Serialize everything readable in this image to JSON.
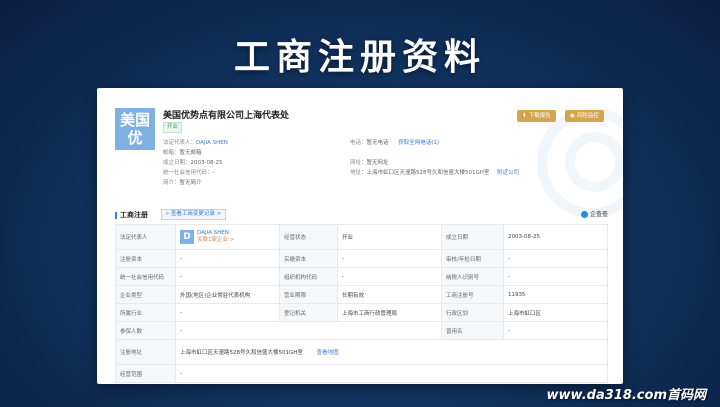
{
  "slide_title": "工商注册资料",
  "company": {
    "logo_text": "美国\n优",
    "name": "美国优势点有限公司上海代表处",
    "status": "开业",
    "legal_rep_label": "法定代表人：",
    "legal_rep": "DAJIA SHEN",
    "email_label": "邮箱：",
    "email": "暂无邮箱",
    "founded_label": "成立日期：",
    "founded": "2003-08-25",
    "credit_code_label": "统一社会信用代码：",
    "credit_code": "-",
    "intro_label": "简介：",
    "intro": "暂无简介",
    "phone_label": "电话：",
    "phone": "暂无电话",
    "phone_more": "获取全网电话(1)",
    "website_label": "网址：",
    "website": "暂无网址",
    "address_label": "地址：",
    "address": "上海市虹口区天潼路528号久和信盛大楼501GH室",
    "nearby": "附近公司"
  },
  "buttons": {
    "download_report": "下载报告",
    "risk_monitor": "风险监控"
  },
  "section": {
    "title": "工商注册",
    "history_link": "查看工商变更记录 >",
    "source": "企查查"
  },
  "table": {
    "legal_rep_label": "法定代表人",
    "rep_avatar": "D",
    "rep_name": "DAJIA SHEN",
    "rep_related": "关联1家企业 >",
    "biz_status_label": "经营状态",
    "biz_status": "开业",
    "founded_label": "成立日期",
    "founded": "2003-08-25",
    "reg_capital_label": "注册资本",
    "reg_capital": "-",
    "paid_capital_label": "实缴资本",
    "paid_capital": "-",
    "approve_date_label": "审核/年检日期",
    "approve_date": "-",
    "credit_code_label": "统一社会信用代码",
    "credit_code": "-",
    "org_code_label": "组织机构代码",
    "org_code": "-",
    "taxpayer_label": "纳税人识别号",
    "taxpayer": "-",
    "company_type_label": "企业类型",
    "company_type": "外国(地区)企业常驻代表机构",
    "term_label": "营业期限",
    "term": "长期有效",
    "reg_no_label": "工商注册号",
    "reg_no": "11935",
    "industry_label": "所属行业",
    "industry": "-",
    "authority_label": "登记机关",
    "authority": "上海市工商行政管理局",
    "district_label": "行政区划",
    "district": "上海市虹口区",
    "insured_label": "参保人数",
    "insured": "-",
    "former_name_label": "曾用名",
    "former_name": "-",
    "address_label": "注册地址",
    "address": "上海市虹口区天潼路528号久和信盛大楼501GH室",
    "map_link": "查看地图",
    "scope_label": "经营范围",
    "scope": "-"
  },
  "watermark": "www.da318.com首码网"
}
